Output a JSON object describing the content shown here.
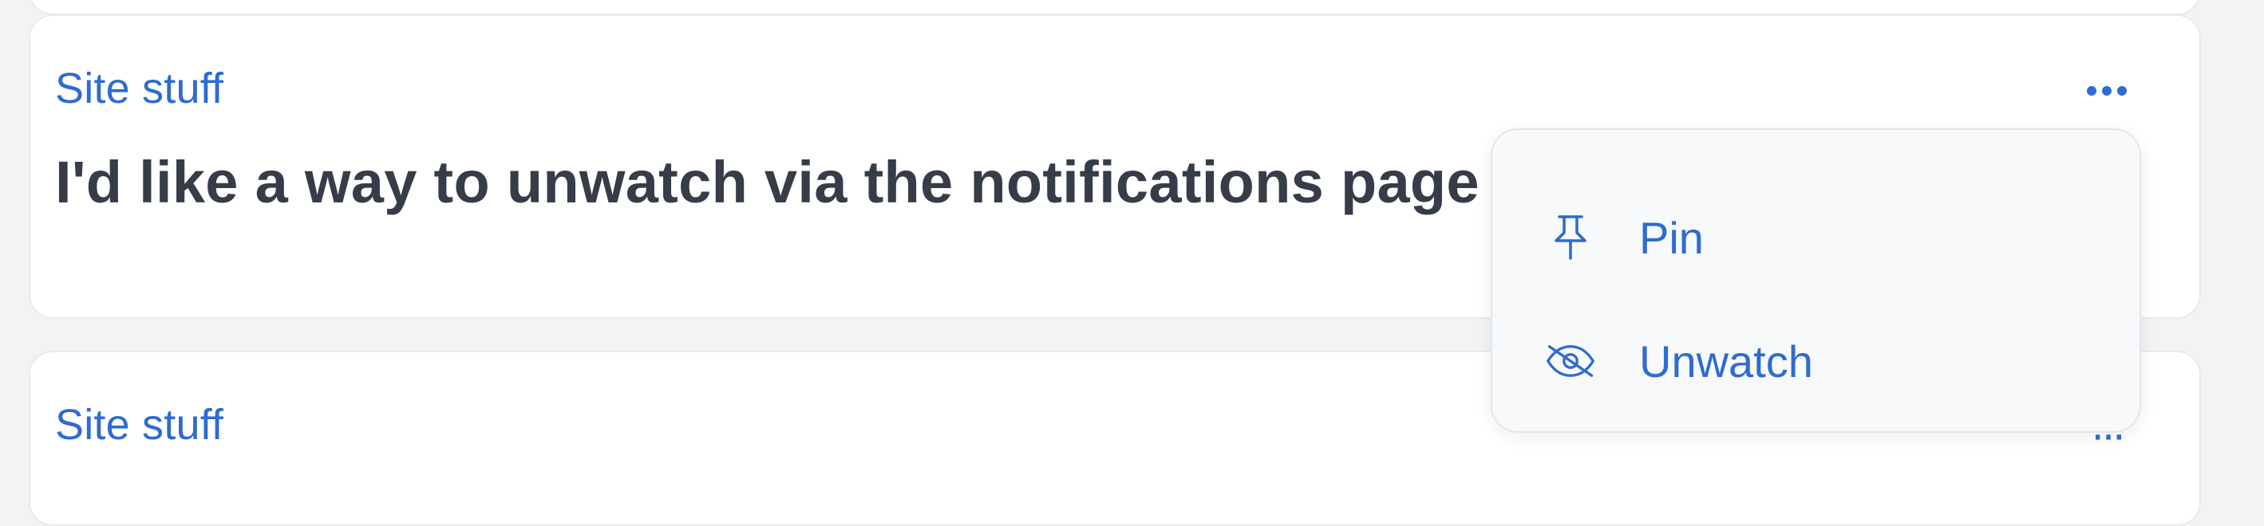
{
  "topics": [
    {
      "category": "Site stuff",
      "title": "I'd like a way to unwatch via the notifications page"
    },
    {
      "category": "Site stuff"
    }
  ],
  "more_icon": "ellipsis-horizontal-icon",
  "menu": {
    "items": [
      {
        "label": "Pin",
        "icon": "pin-icon"
      },
      {
        "label": "Unwatch",
        "icon": "eye-slash-icon"
      }
    ]
  },
  "colors": {
    "accent": "#2f6bd0",
    "title_text": "#363d48",
    "background": "#f1f3f5",
    "card": "#ffffff",
    "menu_bg": "#f7f9fb"
  }
}
